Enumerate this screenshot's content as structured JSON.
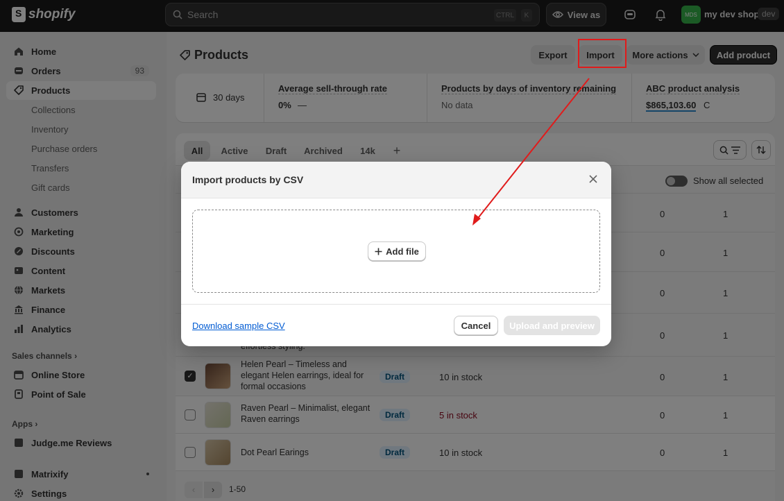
{
  "topbar": {
    "brand": "shopify",
    "search_placeholder": "Search",
    "kbd_ctrl": "CTRL",
    "kbd_k": "K",
    "view_as": "View as",
    "shop_initials": "MDS",
    "shop_name": "my dev shop",
    "shop_badge": "dev"
  },
  "sidebar": {
    "items": [
      {
        "label": "Home",
        "icon": "home-icon"
      },
      {
        "label": "Orders",
        "icon": "orders-icon",
        "count": "93"
      },
      {
        "label": "Products",
        "icon": "tag-icon"
      },
      {
        "label": "Collections"
      },
      {
        "label": "Inventory"
      },
      {
        "label": "Purchase orders"
      },
      {
        "label": "Transfers"
      },
      {
        "label": "Gift cards"
      },
      {
        "label": "Customers",
        "icon": "person-icon"
      },
      {
        "label": "Marketing",
        "icon": "target-icon"
      },
      {
        "label": "Discounts",
        "icon": "discount-icon"
      },
      {
        "label": "Content",
        "icon": "content-icon"
      },
      {
        "label": "Markets",
        "icon": "globe-icon"
      },
      {
        "label": "Finance",
        "icon": "bank-icon"
      },
      {
        "label": "Analytics",
        "icon": "chart-icon"
      },
      {
        "label": "Online Store",
        "icon": "store-icon"
      },
      {
        "label": "Point of Sale",
        "icon": "pos-icon"
      },
      {
        "label": "Judge.me Reviews",
        "icon": "app-icon"
      },
      {
        "label": "Matrixify",
        "icon": "app-icon"
      },
      {
        "label": "Settings",
        "icon": "gear-icon"
      }
    ],
    "section_sales": "Sales channels",
    "section_apps": "Apps"
  },
  "page": {
    "title": "Products",
    "export": "Export",
    "import": "Import",
    "more_actions": "More actions",
    "add_product": "Add product"
  },
  "stats": {
    "range": "30 days",
    "sell_through_label": "Average sell-through rate",
    "sell_through_value": "0%",
    "sell_through_dash": "—",
    "days_inventory_label": "Products by days of inventory remaining",
    "days_inventory_value": "No data",
    "abc_label": "ABC product analysis",
    "abc_value": "$865,103.60",
    "abc_grade": "C"
  },
  "tabs": [
    "All",
    "Active",
    "Draft",
    "Archived",
    "14k"
  ],
  "table": {
    "show_all_selected": "Show all selected",
    "partial_text": "effortless styling.",
    "col_a": [
      "0",
      "0",
      "0",
      "0",
      "0",
      "0",
      "0"
    ],
    "col_b": [
      "1",
      "1",
      "1",
      "1",
      "1",
      "1",
      "1"
    ],
    "rows": [
      {
        "name": "Helen Pearl – Timeless and elegant Helen earrings, ideal for formal occasions",
        "status": "Draft",
        "stock": "10 in stock",
        "a": "0",
        "b": "1"
      },
      {
        "name": "Raven Pearl – Minimalist, elegant Raven earrings",
        "status": "Draft",
        "stock": "5 in stock",
        "a": "0",
        "b": "1"
      },
      {
        "name": "Dot Pearl Earings",
        "status": "Draft",
        "stock": "10 in stock",
        "a": "0",
        "b": "1"
      }
    ],
    "pagination": "1-50"
  },
  "modal": {
    "title": "Import products by CSV",
    "add_file": "Add file",
    "download_sample": "Download sample CSV",
    "cancel": "Cancel",
    "upload": "Upload and preview"
  },
  "colors": {
    "annotation_red": "#e01b1b",
    "link_blue": "#005bd3",
    "low_stock_red": "#8e0b21"
  }
}
